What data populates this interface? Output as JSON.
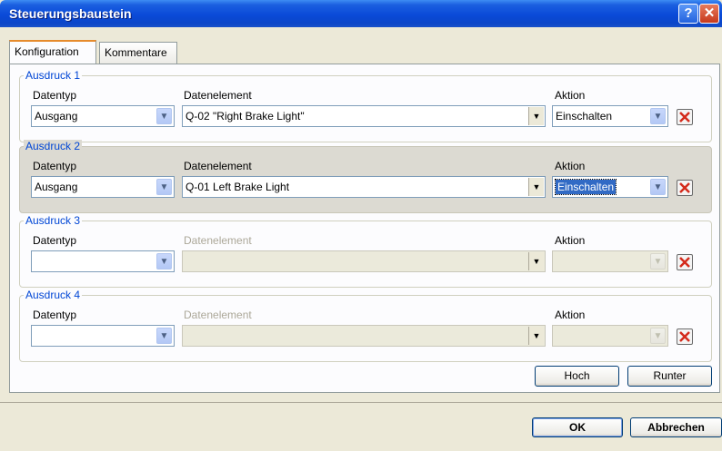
{
  "window": {
    "title": "Steuerungsbaustein",
    "help_label": "?",
    "close_label": "✕"
  },
  "tabs": [
    {
      "label": "Konfiguration"
    },
    {
      "label": "Kommentare"
    }
  ],
  "labels": {
    "datentyp": "Datentyp",
    "datenelement": "Datenelement",
    "aktion": "Aktion"
  },
  "expressions": [
    {
      "legend": "Ausdruck 1",
      "datentyp": "Ausgang",
      "datenelement": "Q-02 \"Right Brake Light\"",
      "aktion": "Einschalten"
    },
    {
      "legend": "Ausdruck 2",
      "datentyp": "Ausgang",
      "datenelement": "Q-01  Left Brake Light",
      "aktion": "Einschalten"
    },
    {
      "legend": "Ausdruck 3",
      "datentyp": "",
      "datenelement": "",
      "aktion": ""
    },
    {
      "legend": "Ausdruck 4",
      "datentyp": "",
      "datenelement": "",
      "aktion": ""
    }
  ],
  "buttons": {
    "hoch": "Hoch",
    "runter": "Runter",
    "ok": "OK",
    "abbrechen": "Abbrechen"
  },
  "colors": {
    "title_bar": "#0a4ad8",
    "legend": "#0046d5",
    "selection": "#316ac5",
    "delete_icon": "#d42b1c"
  }
}
